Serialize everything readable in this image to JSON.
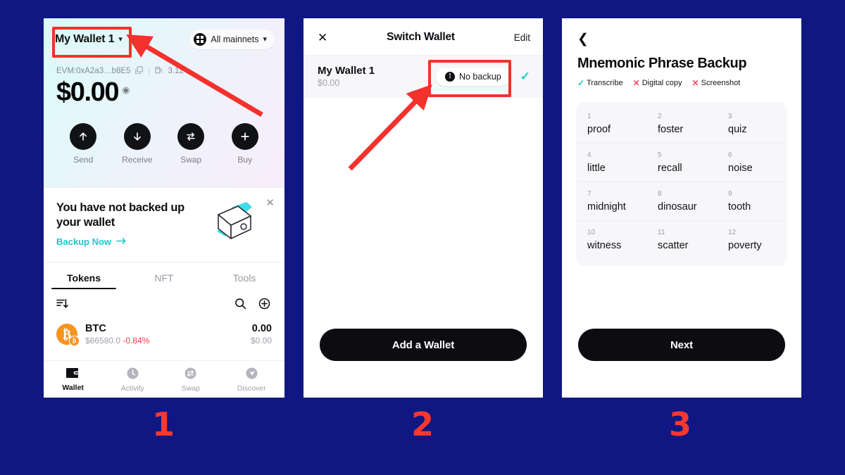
{
  "background_color": "#101782",
  "annotation_color": "#f4312c",
  "panel1": {
    "wallet_selector": {
      "label": "My Wallet 1",
      "chevron": "chevron-down-icon"
    },
    "network_selector": {
      "label": "All mainnets",
      "icon": "grid-icon",
      "chevron": "chevron-down-icon"
    },
    "address": "EVM:0xA2a3…b8E5",
    "copy_icon": "copy-icon",
    "gas_icon": "gas-icon",
    "gas_value": "3.12",
    "balance": "$0.00",
    "eye_icon": "eye-icon",
    "actions": [
      {
        "label": "Send",
        "icon": "arrow-up-icon"
      },
      {
        "label": "Receive",
        "icon": "arrow-down-icon"
      },
      {
        "label": "Swap",
        "icon": "swap-arrows-icon"
      },
      {
        "label": "Buy",
        "icon": "plus-icon"
      }
    ],
    "backup_card": {
      "title": "You have not backed up your wallet",
      "link": "Backup Now",
      "link_arrow": "arrow-right-icon",
      "close_icon": "close-icon",
      "art": "wallet-illustration",
      "link_color": "#1fc7c9"
    },
    "tabs": [
      {
        "label": "Tokens",
        "active": true
      },
      {
        "label": "NFT",
        "active": false
      },
      {
        "label": "Tools",
        "active": false
      }
    ],
    "list_controls": {
      "sort_icon": "sort-icon",
      "search_icon": "search-icon",
      "add_icon": "plus-circle-icon"
    },
    "tokens": [
      {
        "symbol": "BTC",
        "icon": "bitcoin-icon",
        "price": "$66580.0",
        "change": "-0.84%",
        "change_color": "#f5394e",
        "amount": "0.00",
        "value": "$0.00"
      }
    ],
    "bottom_nav": [
      {
        "label": "Wallet",
        "icon": "wallet-icon",
        "active": true
      },
      {
        "label": "Activity",
        "icon": "clock-icon",
        "active": false
      },
      {
        "label": "Swap",
        "icon": "swap-icon",
        "active": false
      },
      {
        "label": "Discover",
        "icon": "compass-icon",
        "active": false
      }
    ]
  },
  "panel2": {
    "close_icon": "close-icon",
    "title": "Switch Wallet",
    "edit_label": "Edit",
    "wallet": {
      "name": "My Wallet 1",
      "balance": "$0.00",
      "badge": "No backup",
      "badge_icon": "warning-icon",
      "selected_icon": "check-icon",
      "selected_color": "#21c7c9"
    },
    "primary_button": "Add a Wallet"
  },
  "panel3": {
    "back_icon": "chevron-left-icon",
    "title": "Mnemonic Phrase Backup",
    "badges": [
      {
        "label": "Transcribe",
        "state": "ok",
        "icon": "check-icon"
      },
      {
        "label": "Digital copy",
        "state": "no",
        "icon": "cross-icon"
      },
      {
        "label": "Screenshot",
        "state": "no",
        "icon": "cross-icon"
      }
    ],
    "mnemonic": [
      {
        "index": "1",
        "word": "proof"
      },
      {
        "index": "2",
        "word": "foster"
      },
      {
        "index": "3",
        "word": "quiz"
      },
      {
        "index": "4",
        "word": "little"
      },
      {
        "index": "5",
        "word": "recall"
      },
      {
        "index": "6",
        "word": "noise"
      },
      {
        "index": "7",
        "word": "midnight"
      },
      {
        "index": "8",
        "word": "dinosaur"
      },
      {
        "index": "9",
        "word": "tooth"
      },
      {
        "index": "10",
        "word": "witness"
      },
      {
        "index": "11",
        "word": "scatter"
      },
      {
        "index": "12",
        "word": "poverty"
      }
    ],
    "primary_button": "Next"
  },
  "steps": [
    {
      "number": "1"
    },
    {
      "number": "2"
    },
    {
      "number": "3"
    }
  ]
}
